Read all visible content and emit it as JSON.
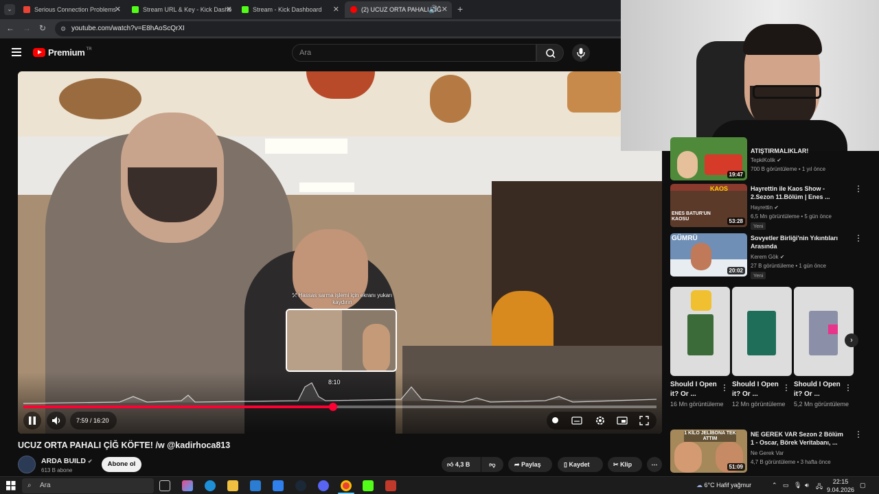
{
  "browser": {
    "tabs": [
      {
        "label": "Serious Connection Problems -",
        "favicon": "gmail-icon",
        "color": "#ea4335"
      },
      {
        "label": "Stream URL & Key - Kick Dashb",
        "favicon": "kick-icon",
        "color": "#53fc18"
      },
      {
        "label": "Stream - Kick Dashboard",
        "favicon": "kick-icon",
        "color": "#53fc18"
      },
      {
        "label": "(2) UCUZ ORTA PAHALI ÇİĞ",
        "favicon": "youtube-icon",
        "color": "#ff0000"
      }
    ],
    "url": "youtube.com/watch?v=E8hAoScQrXI"
  },
  "youtube": {
    "logo_text": "Premium",
    "logo_region": "TR",
    "search_placeholder": "Ara"
  },
  "player": {
    "current_time": "7:59",
    "duration": "16:20",
    "time_display": "7:59 / 16:20",
    "progress_fraction": 0.489,
    "hover_time": "8:10",
    "hint": "⤱ Hassas sarma işlemi için ekranı yukarı kaydırın"
  },
  "video": {
    "title": "UCUZ ORTA PAHALI ÇİĞ KÖFTE! /w @kadirhoca813",
    "channel": "ARDA BUILD",
    "subscribers": "613 B abone",
    "subscribe_label": "Abone ol",
    "likes": "4,3 B",
    "share_label": "Paylaş",
    "save_label": "Kaydet",
    "clip_label": "Klip"
  },
  "recommendations": [
    {
      "title": "ATIŞTIRMALIKLAR!",
      "channel": "TepkiKolik",
      "meta": "700 B görüntüleme • 1 yıl önce",
      "duration": "19:47",
      "new": ""
    },
    {
      "title": "Hayrettin ile Kaos Show - 2.Sezon 11.Bölüm | Enes ...",
      "channel": "Hayrettin",
      "meta": "6,5 Mn görüntüleme • 5 gün önce",
      "duration": "53:28",
      "new": "Yeni"
    },
    {
      "title": "Sovyetler Birliği'nin Yıkıntıları Arasında",
      "channel": "Kerem Gök",
      "meta": "27 B görüntüleme • 1 gün önce",
      "duration": "20:02",
      "new": "Yeni"
    },
    {
      "title": "NE GEREK VAR Sezon 2 Bölüm 1 - Oscar, Börek Veritabanı, ...",
      "channel": "Ne Gerek Var",
      "meta": "4,7 B görüntüleme • 3 hafta önce",
      "duration": "51:09",
      "new": ""
    }
  ],
  "thumb_texts": {
    "kaos": "KAOS",
    "enes": "ENES BATUR'UN KAOSU",
    "gumru": "GÜMRÜ",
    "jelibon": "1 KİLO JELİBONA TEK ATTIM"
  },
  "shorts": [
    {
      "title": "Should I Open it? Or ...",
      "views": "16 Mn görüntüleme"
    },
    {
      "title": "Should I Open it? Or ...",
      "views": "12 Mn görüntüleme"
    },
    {
      "title": "Should I Open it? Or ...",
      "views": "5,2 Mn görüntüleme"
    }
  ],
  "taskbar": {
    "search_placeholder": "Ara",
    "weather": "6°C  Hafif yağmur",
    "time": "22:15",
    "date": "9.04.2026"
  },
  "colors": {
    "accent": "#ff0033",
    "background": "#0f0f0f"
  }
}
